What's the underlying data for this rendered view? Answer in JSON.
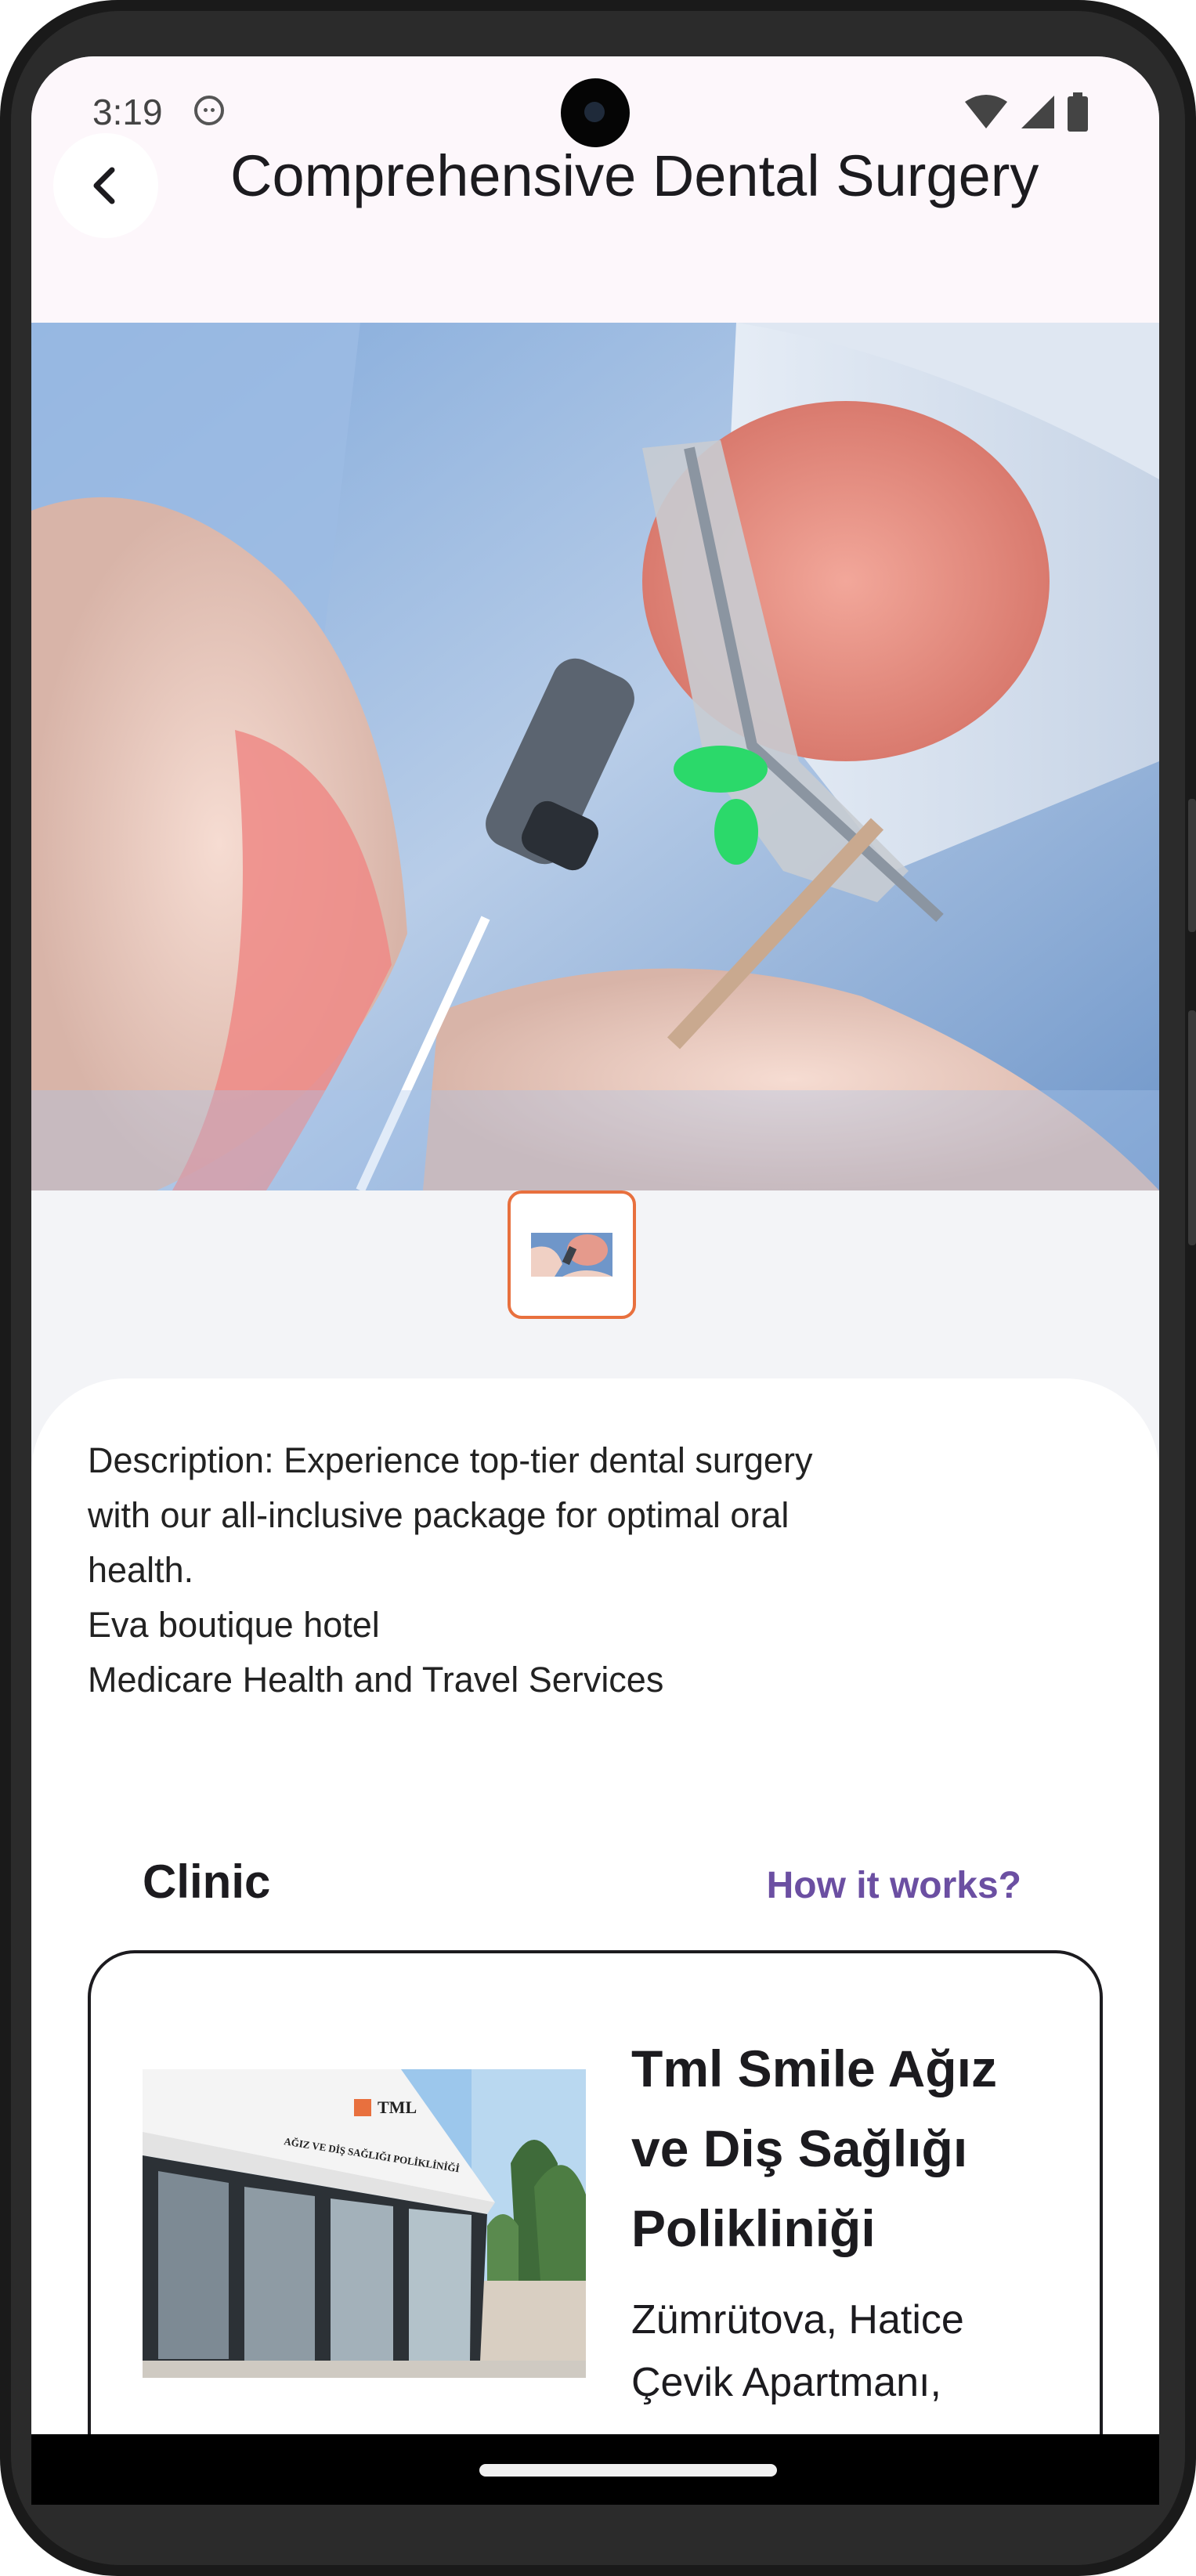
{
  "status_bar": {
    "time": "3:19"
  },
  "header": {
    "title": "Comprehensive Dental Surgery"
  },
  "description": {
    "lines": [
      "Description: Experience top-tier dental surgery",
      "with our all-inclusive package for optimal oral",
      "health.",
      "Eva boutique hotel",
      "Medicare Health and Travel Services"
    ]
  },
  "clinic_section": {
    "label": "Clinic",
    "link": "How it works?",
    "link_color": "#6b4fa2"
  },
  "clinic": {
    "name_lines": [
      "Tml Smile Ağız",
      "ve Diş Sağlığı",
      "Polikliniği"
    ],
    "address_lines": [
      "Zümrütova, Hatice",
      "Çevik Apartmanı,"
    ],
    "sign_brand": "TML",
    "sign_text": "AĞIZ VE DİŞ SAĞLIĞI POLİKLİNİĞİ"
  },
  "colors": {
    "accent_border": "#e8703e",
    "app_bar": "#fdf7fb"
  },
  "icons": {
    "back": "chevron-left-icon",
    "wifi": "wifi-icon",
    "signal": "signal-icon",
    "battery": "battery-icon"
  }
}
